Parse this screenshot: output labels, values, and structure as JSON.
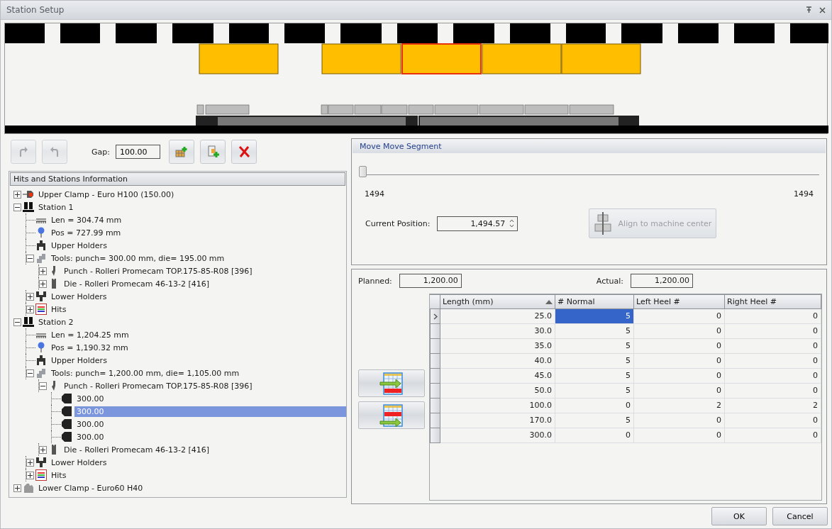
{
  "window": {
    "title": "Station Setup"
  },
  "toolbar": {
    "buttons": [
      {
        "kind": "redo",
        "disabled": true
      },
      {
        "kind": "undo",
        "disabled": true
      }
    ],
    "gap_label": "Gap:",
    "gap_value": "100.00",
    "actions": [
      {
        "kind": "add-station"
      },
      {
        "kind": "insert-station"
      },
      {
        "kind": "delete"
      }
    ]
  },
  "tree": {
    "title": "Hits and Stations Information",
    "nodes": [
      {
        "label": "Upper Clamp - Euro H100 (150.00)",
        "kind": "clamp",
        "expanded": false,
        "selected": false
      },
      {
        "label": "Station 1",
        "kind": "station",
        "expanded": true,
        "selected": false,
        "children": [
          {
            "label": "Len = 304.74 mm",
            "kind": "length",
            "selected": false
          },
          {
            "label": "Pos = 727.99 mm",
            "kind": "position",
            "selected": false
          },
          {
            "label": "Upper Holders",
            "kind": "holder",
            "selected": false
          },
          {
            "label": "Tools: punch= 300.00 mm, die= 195.00 mm",
            "kind": "tools",
            "expanded": true,
            "selected": false,
            "children": [
              {
                "label": "Punch - Rolleri Promecam TOP.175-85-R08 [396]",
                "kind": "punch",
                "expanded": false,
                "selected": false
              },
              {
                "label": "Die - Rolleri Promecam 46-13-2 [416]",
                "kind": "die",
                "expanded": false,
                "selected": false
              }
            ]
          },
          {
            "label": "Lower Holders",
            "kind": "lower-holder",
            "expanded": false,
            "selected": false
          },
          {
            "label": "Hits",
            "kind": "hits",
            "expanded": false,
            "selected": false
          }
        ]
      },
      {
        "label": "Station 2",
        "kind": "station",
        "expanded": true,
        "selected": false,
        "children": [
          {
            "label": "Len = 1,204.25 mm",
            "kind": "length",
            "selected": false
          },
          {
            "label": "Pos = 1,190.32 mm",
            "kind": "position",
            "selected": false
          },
          {
            "label": "Upper Holders",
            "kind": "holder",
            "selected": false
          },
          {
            "label": "Tools: punch= 1,200.00 mm, die= 1,105.00 mm",
            "kind": "tools",
            "expanded": true,
            "selected": false,
            "children": [
              {
                "label": "Punch - Rolleri Promecam TOP.175-85-R08 [396]",
                "kind": "punch",
                "expanded": true,
                "selected": false,
                "children": [
                  {
                    "label": "300.00",
                    "kind": "segment",
                    "selected": false
                  },
                  {
                    "label": "300.00",
                    "kind": "segment",
                    "selected": true
                  },
                  {
                    "label": "300.00",
                    "kind": "segment",
                    "selected": false
                  },
                  {
                    "label": "300.00",
                    "kind": "segment",
                    "selected": false
                  }
                ]
              },
              {
                "label": "Die - Rolleri Promecam 46-13-2 [416]",
                "kind": "die",
                "expanded": false,
                "selected": false
              }
            ]
          },
          {
            "label": "Lower Holders",
            "kind": "lower-holder",
            "expanded": false,
            "selected": false
          },
          {
            "label": "Hits",
            "kind": "hits",
            "expanded": false,
            "selected": false
          }
        ]
      },
      {
        "label": "Lower Clamp - Euro60 H40",
        "kind": "lower-clamp",
        "expanded": false,
        "selected": false
      }
    ]
  },
  "move_panel": {
    "title": "Move Move Segment",
    "slider": {
      "level": 0,
      "min_label": "1494",
      "max_label": "1494"
    },
    "position_label": "Current Position:",
    "position_value": "1,494.57",
    "align_button": {
      "label": "Align to machine center",
      "disabled": true
    }
  },
  "segments_panel": {
    "planned_label": "Planned:",
    "planned_value": "1,200.00",
    "actual_label": "Actual:",
    "actual_value": "1,200.00",
    "side_buttons": [
      {
        "kind": "table-right"
      },
      {
        "kind": "table-left"
      }
    ],
    "table": {
      "columns": [
        {
          "label": "Length (mm)",
          "sorted": true
        },
        {
          "label": "# Normal",
          "sorted": false
        },
        {
          "label": "Left Heel #",
          "sorted": false
        },
        {
          "label": "Right Heel #",
          "sorted": false
        }
      ],
      "rows": [
        {
          "selected": true,
          "cells": [
            "25.0",
            "5",
            "0",
            "0"
          ],
          "cell_selected": [
            false,
            true,
            false,
            false
          ]
        },
        {
          "selected": false,
          "cells": [
            "30.0",
            "5",
            "0",
            "0"
          ]
        },
        {
          "selected": false,
          "cells": [
            "35.0",
            "5",
            "0",
            "0"
          ]
        },
        {
          "selected": false,
          "cells": [
            "40.0",
            "5",
            "0",
            "0"
          ]
        },
        {
          "selected": false,
          "cells": [
            "45.0",
            "5",
            "0",
            "0"
          ]
        },
        {
          "selected": false,
          "cells": [
            "50.0",
            "5",
            "0",
            "0"
          ]
        },
        {
          "selected": false,
          "cells": [
            "100.0",
            "0",
            "2",
            "2"
          ]
        },
        {
          "selected": false,
          "cells": [
            "170.0",
            "5",
            "0",
            "0"
          ]
        },
        {
          "selected": false,
          "cells": [
            "300.0",
            "0",
            "0",
            "0"
          ]
        }
      ]
    }
  },
  "buttons": [
    "OK",
    "Cancel"
  ]
}
